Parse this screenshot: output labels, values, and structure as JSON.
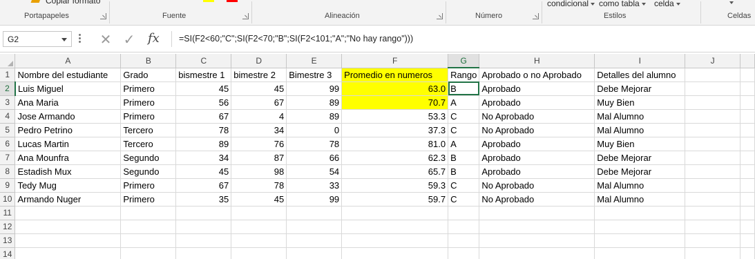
{
  "ribbon": {
    "copy_format": "Copiar formato",
    "conditional": "condicional",
    "as_table": "como tabla",
    "cell": "celda",
    "groups": [
      "Portapapeles",
      "Fuente",
      "Alineación",
      "Número",
      "Estilos",
      "Celdas"
    ],
    "font_color": "#ffff00",
    "fill_color": "#ff0000"
  },
  "formula_bar": {
    "name_box": "G2",
    "fx": "fx",
    "formula": "=SI(F2<60;\"C\";SI(F2<70;\"B\";SI(F2<101;\"A\";\"No hay rango\")))"
  },
  "sheet": {
    "columns": [
      "A",
      "B",
      "C",
      "D",
      "E",
      "F",
      "G",
      "H",
      "I",
      "J"
    ],
    "selected_column": "G",
    "selected_row": "2",
    "highlight_color": "#ffff00",
    "row_numbers": [
      "1",
      "2",
      "3",
      "4",
      "5",
      "6",
      "7",
      "8",
      "9",
      "10",
      "11",
      "12",
      "13",
      "14"
    ],
    "header": [
      "Nombre del estudiante",
      "Grado",
      "bismestre 1",
      "bimestre 2",
      "Bimestre 3",
      "Promedio en numeros",
      "Rango",
      "Aprobado o no Aprobado",
      "Detalles del alumno"
    ],
    "rows": [
      [
        "Luis Miguel",
        "Primero",
        "45",
        "45",
        "99",
        "63.0",
        "B",
        "Aprobado",
        "Debe Mejorar"
      ],
      [
        "Ana Maria",
        "Primero",
        "56",
        "67",
        "89",
        "70.7",
        "A",
        "Aprobado",
        "Muy Bien"
      ],
      [
        "Jose Armando",
        "Primero",
        "67",
        "4",
        "89",
        "53.3",
        "C",
        "No Aprobado",
        "Mal Alumno"
      ],
      [
        "Pedro Petrino",
        "Tercero",
        "78",
        "34",
        "0",
        "37.3",
        "C",
        "No Aprobado",
        "Mal Alumno"
      ],
      [
        "Lucas Martin",
        "Tercero",
        "89",
        "76",
        "78",
        "81.0",
        "A",
        "Aprobado",
        "Muy Bien"
      ],
      [
        "Ana Mounfra",
        "Segundo",
        "34",
        "87",
        "66",
        "62.3",
        "B",
        "Aprobado",
        "Debe Mejorar"
      ],
      [
        "Estadish Mux",
        "Segundo",
        "45",
        "98",
        "54",
        "65.7",
        "B",
        "Aprobado",
        "Debe Mejorar"
      ],
      [
        "Tedy Mug",
        "Primero",
        "67",
        "78",
        "33",
        "59.3",
        "C",
        "No Aprobado",
        "Mal Alumno"
      ],
      [
        "Armando Nuger",
        "Primero",
        "35",
        "45",
        "99",
        "59.7",
        "C",
        "No Aprobado",
        "Mal Alumno"
      ]
    ]
  }
}
